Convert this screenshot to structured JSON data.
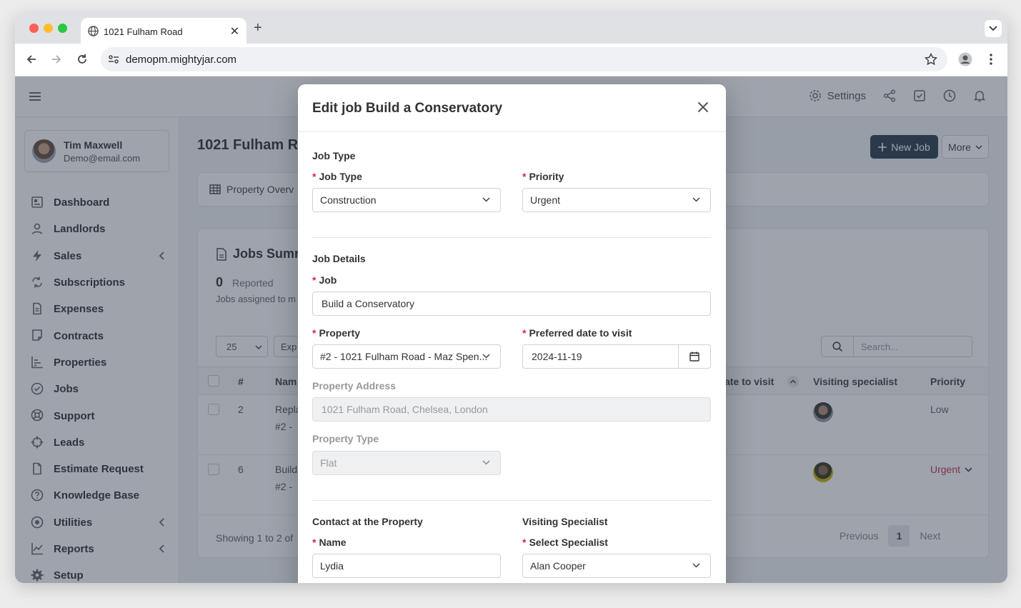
{
  "browser": {
    "tab_title": "1021 Fulham Road",
    "url": "demopm.mightyjar.com"
  },
  "topbar": {
    "settings_label": "Settings"
  },
  "user": {
    "name": "Tim Maxwell",
    "email": "Demo@email.com"
  },
  "sidebar": {
    "items": [
      {
        "label": "Dashboard",
        "icon": "dashboard-icon"
      },
      {
        "label": "Landlords",
        "icon": "user-icon"
      },
      {
        "label": "Sales",
        "icon": "bolt-icon"
      },
      {
        "label": "Subscriptions",
        "icon": "repeat-icon"
      },
      {
        "label": "Expenses",
        "icon": "document-icon"
      },
      {
        "label": "Contracts",
        "icon": "contract-icon"
      },
      {
        "label": "Properties",
        "icon": "chart-icon"
      },
      {
        "label": "Jobs",
        "icon": "check-circle-icon"
      },
      {
        "label": "Support",
        "icon": "lifebuoy-icon"
      },
      {
        "label": "Leads",
        "icon": "crosshair-icon"
      },
      {
        "label": "Estimate Request",
        "icon": "file-icon"
      },
      {
        "label": "Knowledge Base",
        "icon": "question-icon"
      },
      {
        "label": "Utilities",
        "icon": "dot-circle-icon"
      },
      {
        "label": "Reports",
        "icon": "line-chart-icon"
      },
      {
        "label": "Setup",
        "icon": "gear-icon"
      }
    ]
  },
  "page": {
    "title": "1021 Fulham Ro",
    "new_job_label": "New Job",
    "more_label": "More",
    "overview_tab": "Property Overv"
  },
  "jobs": {
    "title": "Jobs Sumr",
    "reported_count": "0",
    "reported_label": "Reported",
    "subtitle": "Jobs assigned to m",
    "page_size": "25",
    "export_label": "Exp",
    "search_placeholder": "Search...",
    "headers": {
      "num": "#",
      "name": "Nam",
      "date": "ate to visit",
      "specialist": "Visiting specialist",
      "priority": "Priority"
    },
    "rows": [
      {
        "num": "2",
        "name": "Repla",
        "sub": "#2 - ",
        "date": "",
        "priority": "Low"
      },
      {
        "num": "6",
        "name": "Build",
        "sub": "#2 - ",
        "date": "",
        "priority": "Urgent"
      }
    ],
    "showing": "Showing 1 to 2 of",
    "prev_label": "Previous",
    "current_page": "1",
    "next_label": "Next"
  },
  "modal": {
    "title": "Edit job Build a Conservatory",
    "job_type_section": "Job Type",
    "job_type_label": "Job Type",
    "job_type_value": "Construction",
    "priority_label": "Priority",
    "priority_value": "Urgent",
    "job_details_section": "Job Details",
    "job_label": "Job",
    "job_value": "Build a Conservatory",
    "property_label": "Property",
    "property_value": "#2 - 1021 Fulham Road - Maz Spen...",
    "preferred_date_label": "Preferred date to visit",
    "preferred_date_value": "2024-11-19",
    "address_label": "Property Address",
    "address_value": "1021 Fulham Road, Chelsea, London",
    "property_type_label": "Property Type",
    "property_type_value": "Flat",
    "contact_section": "Contact at the Property",
    "name_label": "Name",
    "name_value": "Lydia",
    "specialist_section": "Visiting Specialist",
    "select_specialist_label": "Select Specialist",
    "specialist_value": "Alan Cooper"
  }
}
